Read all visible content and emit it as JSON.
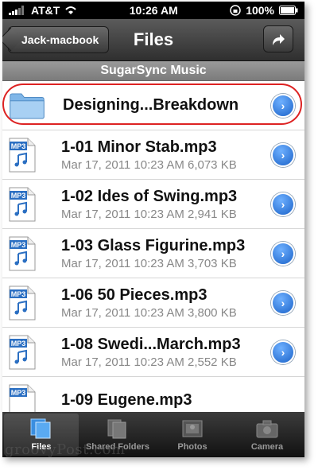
{
  "status_bar": {
    "carrier": "AT&T",
    "time": "10:26 AM",
    "battery": "100%"
  },
  "nav": {
    "back_label": "Jack-macbook",
    "title": "Files"
  },
  "section_title": "SugarSync Music",
  "folder": {
    "name": "Designing...Breakdown"
  },
  "files": [
    {
      "name": "1-01 Minor Stab.mp3",
      "meta": "Mar 17, 2011 10:23 AM 6,073 KB"
    },
    {
      "name": "1-02 Ides of Swing.mp3",
      "meta": "Mar 17, 2011 10:23 AM 2,941 KB"
    },
    {
      "name": "1-03 Glass Figurine.mp3",
      "meta": "Mar 17, 2011 10:23 AM 3,703 KB"
    },
    {
      "name": "1-06 50 Pieces.mp3",
      "meta": "Mar 17, 2011 10:23 AM 3,800 KB"
    },
    {
      "name": "1-08 Swedi...March.mp3",
      "meta": "Mar 17, 2011 10:23 AM 2,552 KB"
    },
    {
      "name": "1-09 Eugene.mp3",
      "meta": ""
    }
  ],
  "tabs": [
    {
      "label": "Files",
      "icon": "files-icon",
      "active": true
    },
    {
      "label": "Shared Folders",
      "icon": "shared-folders-icon",
      "active": false
    },
    {
      "label": "Photos",
      "icon": "photos-icon",
      "active": false
    },
    {
      "label": "Camera",
      "icon": "camera-icon",
      "active": false
    }
  ],
  "watermark": "groovyPost.com",
  "colors": {
    "highlight": "#dd2222",
    "disclosure": "#1b63c9"
  }
}
